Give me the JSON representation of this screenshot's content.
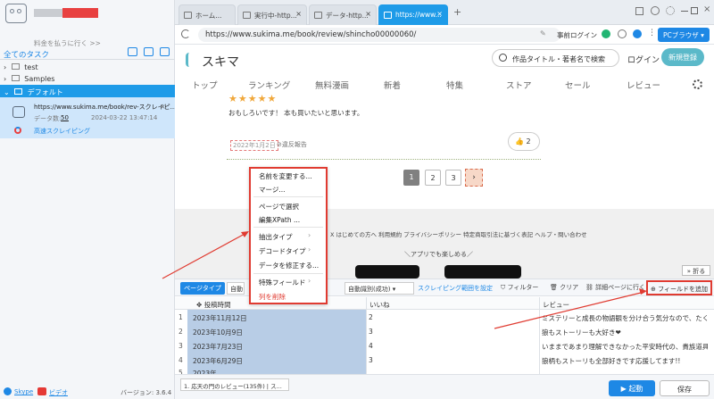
{
  "sidebar": {
    "username": "■■■ ■■■",
    "pay_link": "料金を払うに行く >>",
    "all_tasks": "全てのタスク",
    "groups": [
      {
        "name": "test"
      },
      {
        "name": "Samples"
      },
      {
        "name": "デフォルト"
      }
    ],
    "task": {
      "url": "https://www.sukima.me/book/rev-スクレイピ...",
      "count_label": "データ数:",
      "count": "50",
      "date": "2024-03-22 13:47:14",
      "mode": "高速スクレイピング"
    },
    "footer": {
      "skype": "Skype",
      "video": "ビデオ",
      "version": "バージョン: 3.6.4"
    }
  },
  "browser": {
    "tabs": [
      {
        "label": "ホーム..."
      },
      {
        "label": "実行中-http..."
      },
      {
        "label": "データ-http..."
      },
      {
        "label": "https://www..."
      }
    ],
    "url": "https://www.sukima.me/book/review/shincho00000060/",
    "login_hint": "事前ログイン",
    "pc_browser": "PCブラウザ"
  },
  "site": {
    "logo": "スキマ",
    "search_placeholder": "作品タイトル・著者名で検索",
    "login": "ログイン",
    "signup": "新規登録",
    "nav": [
      "トップ",
      "ランキング",
      "無料漫画",
      "新着",
      "特集",
      "ストア",
      "セール",
      "レビュー"
    ],
    "review_text": "おもしろいです！ 本も買いたいと思います。",
    "review_date": "2022年1月2日",
    "report": "違反報告",
    "likes": "2",
    "pages": [
      "1",
      "2",
      "3"
    ],
    "footer_links": "X はじめての方へ 利用規約 プライバシーポリシー 特定商取引法に基づく表記 ヘルプ・問い合わせ",
    "app_text": "＼アプリでも楽しめる／"
  },
  "context_menu": {
    "items": [
      "名前を変更する...",
      "マージ...",
      "ページで選択",
      "編集XPath ...",
      "抽出タイプ",
      "デコードタイプ",
      "データを修正する...",
      "特殊フィールド",
      "列を削除"
    ]
  },
  "toolbar": {
    "page_type": "ページタイプ",
    "auto_label": "自動識別(成功)",
    "scrape_range": "スクレイピング範囲を設定",
    "filter": "フィルター",
    "clear": "クリア",
    "detail_page": "詳細ページに行く",
    "add_field": "フィールドを追加",
    "fold": "折る"
  },
  "table": {
    "headers": [
      "投稿時間",
      "いいね",
      "レビュー"
    ],
    "rows": [
      {
        "n": "1",
        "date": "2023年11月12日",
        "likes": "2",
        "review": "ミステリーと成長の物語観を分け合う気分なので、たくさんの..."
      },
      {
        "n": "2",
        "date": "2023年10月9日",
        "likes": "3",
        "review": "狼もストーリーも大好き❤"
      },
      {
        "n": "3",
        "date": "2023年7月23日",
        "likes": "4",
        "review": "いままであまり理解できなかった平安時代の、貴族道具と用..."
      },
      {
        "n": "4",
        "date": "2023年6月29日",
        "likes": "3",
        "review": "狼柄もストーリも全部好きです応援してます!!"
      },
      {
        "n": "5",
        "date": "2023年...",
        "likes": "",
        "review": ""
      }
    ]
  },
  "bottom": {
    "task_tab": "1. 応天の門のレビュー(135件) | ス...",
    "start": "起動",
    "save": "保存"
  }
}
